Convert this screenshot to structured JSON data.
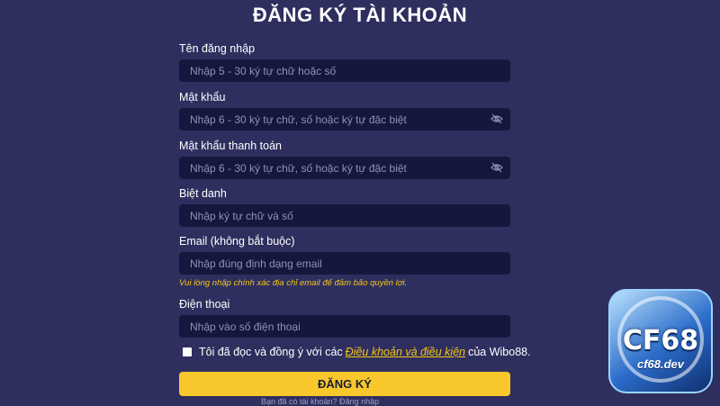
{
  "page_title": "ĐĂNG KÝ TÀI KHOẢN",
  "fields": {
    "username": {
      "label": "Tên đăng nhập",
      "placeholder": "Nhập 5 - 30 ký tự chữ hoặc số"
    },
    "password": {
      "label": "Mật khẩu",
      "placeholder": "Nhập 6 - 30 ký tự chữ, số hoặc ký tự đặc biệt"
    },
    "payment_password": {
      "label": "Mật khẩu thanh toán",
      "placeholder": "Nhập 6 - 30 ký tự chữ, số hoặc ký tự đặc biệt"
    },
    "nickname": {
      "label": "Biệt danh",
      "placeholder": "Nhập ký tự chữ và số"
    },
    "email": {
      "label": "Email (không bắt buộc)",
      "placeholder": "Nhập đúng định dạng email",
      "hint": "Vui lòng nhập chính xác địa chỉ email để đảm bảo quyền lợi."
    },
    "phone": {
      "label": "Điện thoại",
      "placeholder": "Nhập vào số điện thoại"
    }
  },
  "agreement": {
    "prefix": "Tôi đã đọc và đồng ý với các",
    "link": "Điều khoản và điều kiện",
    "suffix": "của Wibo88.",
    "checked": false
  },
  "submit_label": "ĐĂNG KÝ",
  "bottom_text": "Bạn đã có tài khoản? Đăng nhập",
  "logo": {
    "brand": "CF68",
    "domain": "cf68.dev"
  },
  "colors": {
    "background": "#2e2f5e",
    "input_bg": "#15173d",
    "accent": "#f7c72c",
    "hint": "#f5c518"
  }
}
